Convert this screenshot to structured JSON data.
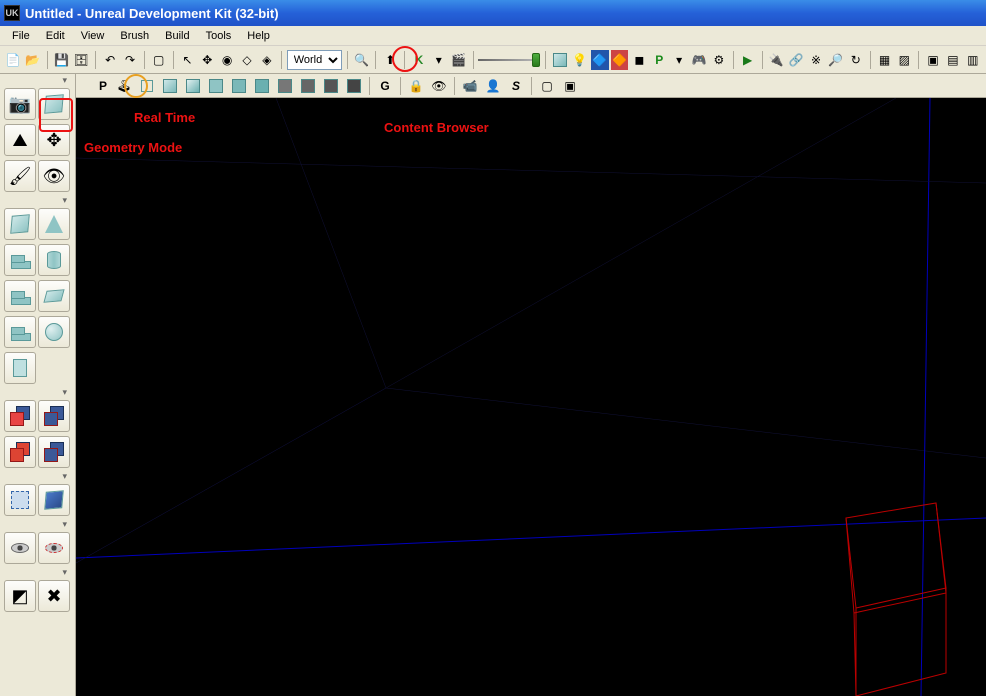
{
  "titlebar": {
    "title": "Untitled - Unreal Development Kit (32-bit)"
  },
  "menu": {
    "items": [
      "File",
      "Edit",
      "View",
      "Brush",
      "Build",
      "Tools",
      "Help"
    ]
  },
  "main_toolbar": {
    "dropdown_value": "World",
    "letter_P": "P",
    "letter_K": "K"
  },
  "sec_toolbar": {
    "letter_P": "P",
    "letter_G": "G",
    "letter_S": "S"
  },
  "annotations": {
    "real_time": "Real Time",
    "geometry_mode": "Geometry Mode",
    "content_browser": "Content Browser"
  },
  "left_tools": {
    "groups": [
      [
        "camera-mode",
        "geometry-mode"
      ],
      [
        "terrain",
        "texture-align"
      ],
      [
        "mesh-paint",
        "static-mesh"
      ]
    ],
    "brushes": [
      [
        "cube",
        "cone"
      ],
      [
        "curved-stair",
        "cylinder"
      ],
      [
        "linear-stair",
        "sheet"
      ],
      [
        "spiral-stair",
        "sphere"
      ],
      [
        "volumetric",
        ""
      ]
    ],
    "csg": [
      [
        "csg-add",
        "csg-subtract"
      ],
      [
        "csg-intersect",
        "csg-deintersect"
      ]
    ],
    "select": [
      [
        "select-special",
        "select-brush"
      ]
    ],
    "show": [
      [
        "show-selected",
        "hide-selected"
      ]
    ],
    "misc": [
      [
        "invert-selection",
        "misc-tool"
      ]
    ]
  }
}
